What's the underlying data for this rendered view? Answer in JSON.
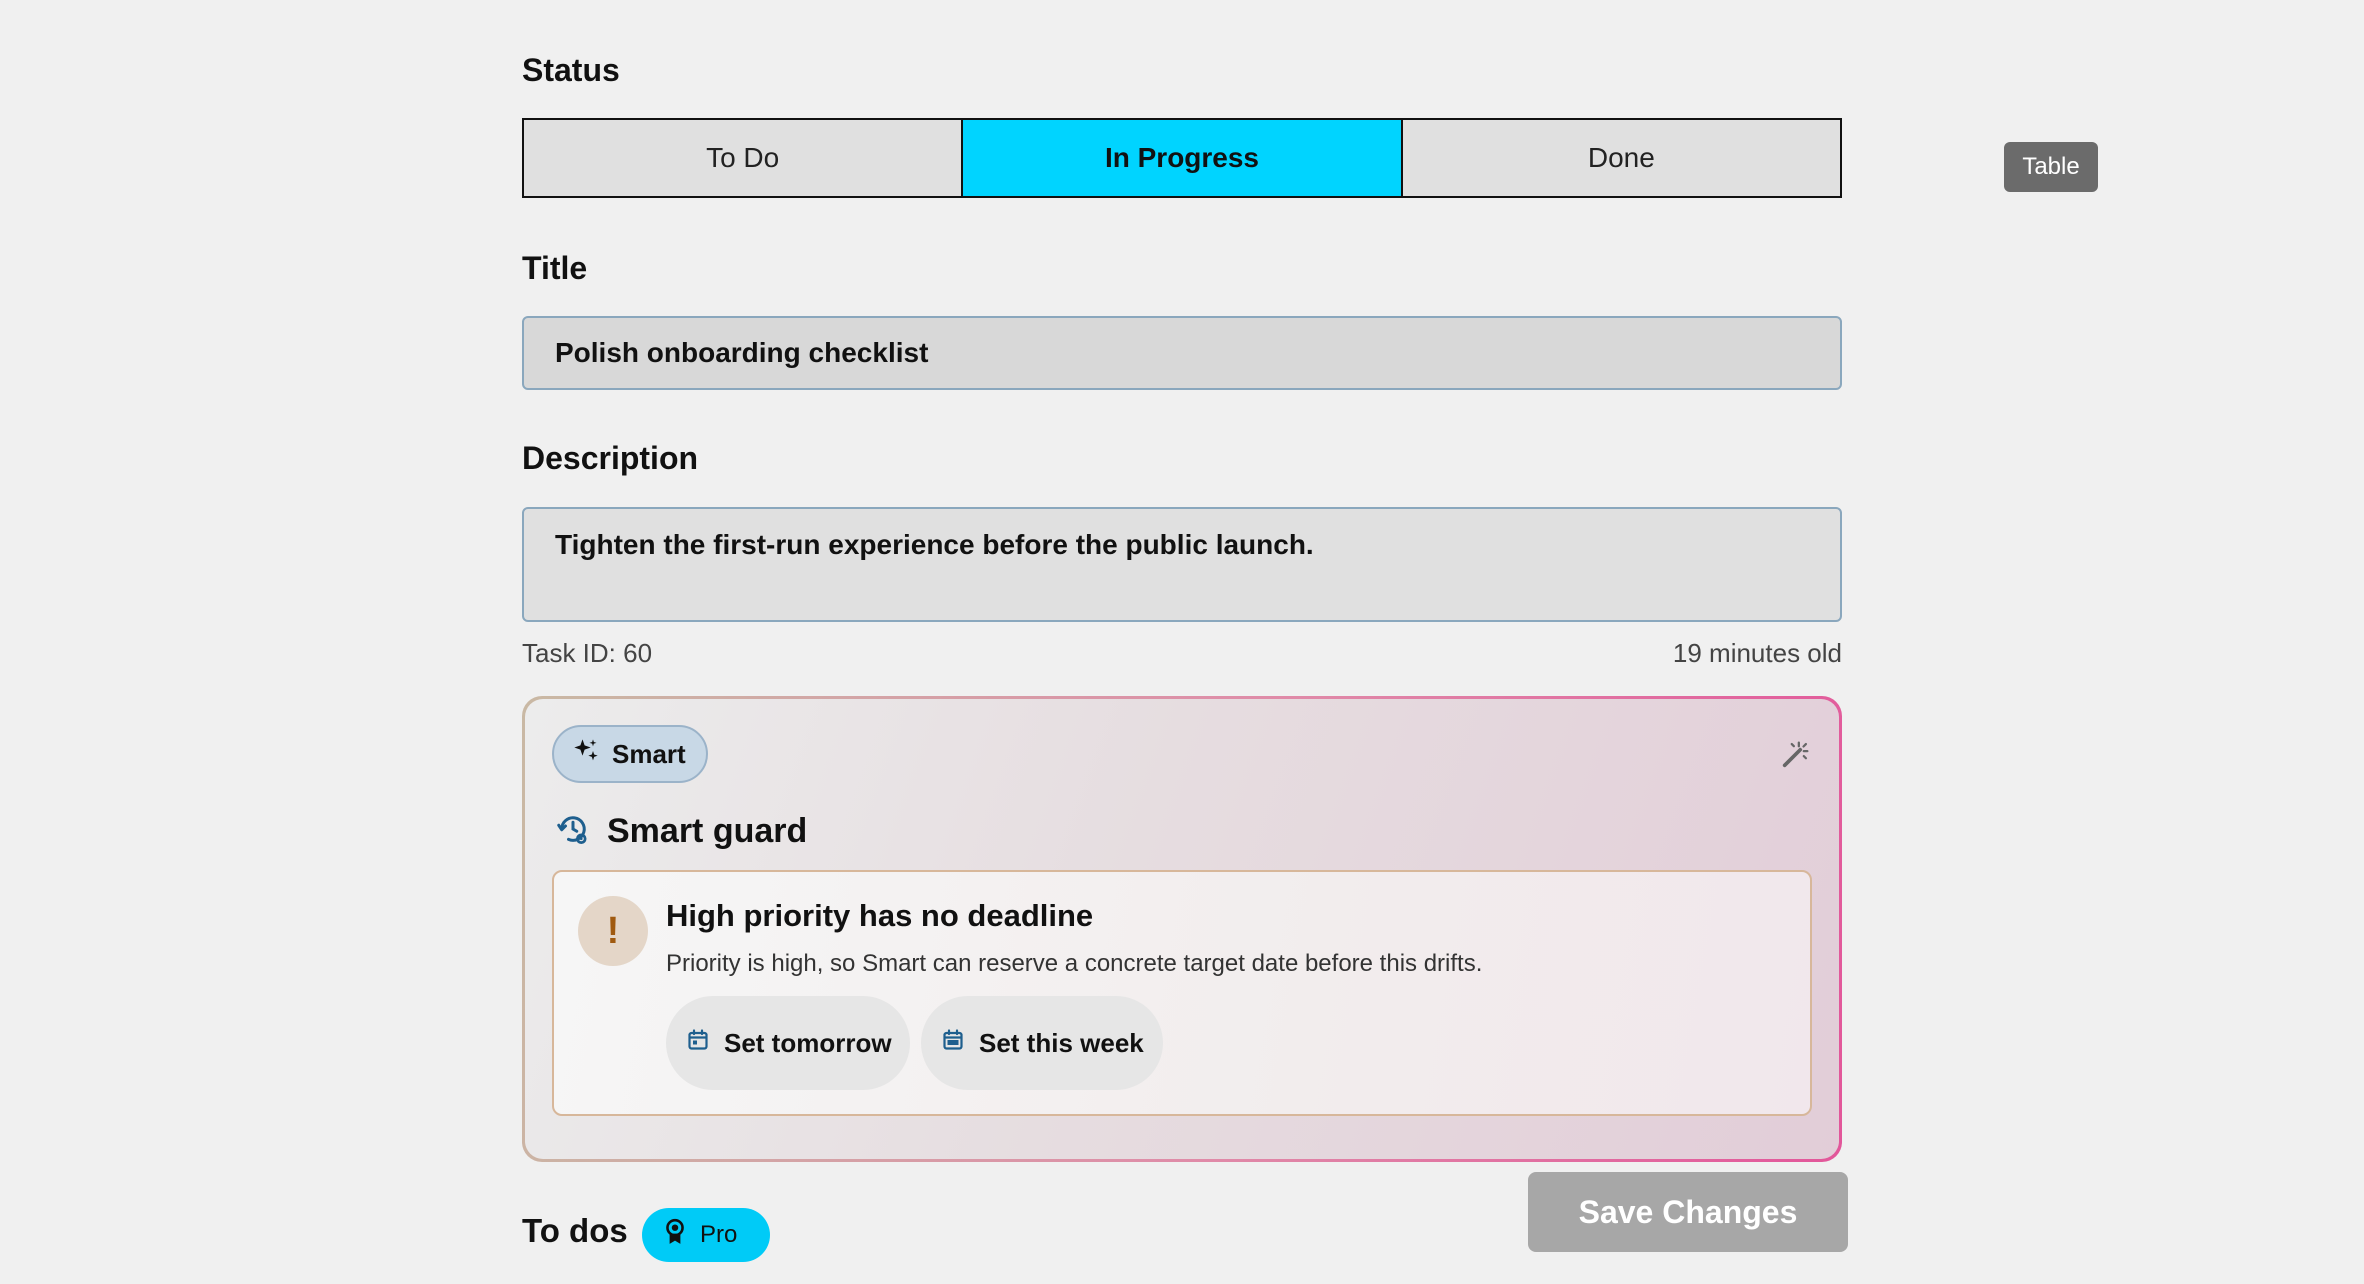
{
  "status": {
    "label": "Status",
    "options": [
      "To Do",
      "In Progress",
      "Done"
    ],
    "selected": "In Progress"
  },
  "view_toggle": {
    "label": "Table"
  },
  "title_field": {
    "label": "Title",
    "value": "Polish onboarding checklist"
  },
  "description_field": {
    "label": "Description",
    "value": "Tighten the first-run experience before the public launch."
  },
  "meta": {
    "task_id": "Task ID: 60",
    "age": "19 minutes old"
  },
  "smart": {
    "badge": "Smart",
    "guard_title": "Smart guard",
    "alert": {
      "title": "High priority has no deadline",
      "body": "Priority is high, so Smart can reserve a concrete target date before this drifts.",
      "actions": [
        "Set tomorrow",
        "Set this week"
      ]
    }
  },
  "save_button": "Save Changes",
  "todos": {
    "label": "To dos",
    "badge": "Pro"
  },
  "colors": {
    "accent": "#00d4ff",
    "pro_badge": "#00cbf7",
    "save_disabled": "#a7a7a7",
    "alert_icon": "#a05a10",
    "icon_blue": "#1e5f8e"
  }
}
